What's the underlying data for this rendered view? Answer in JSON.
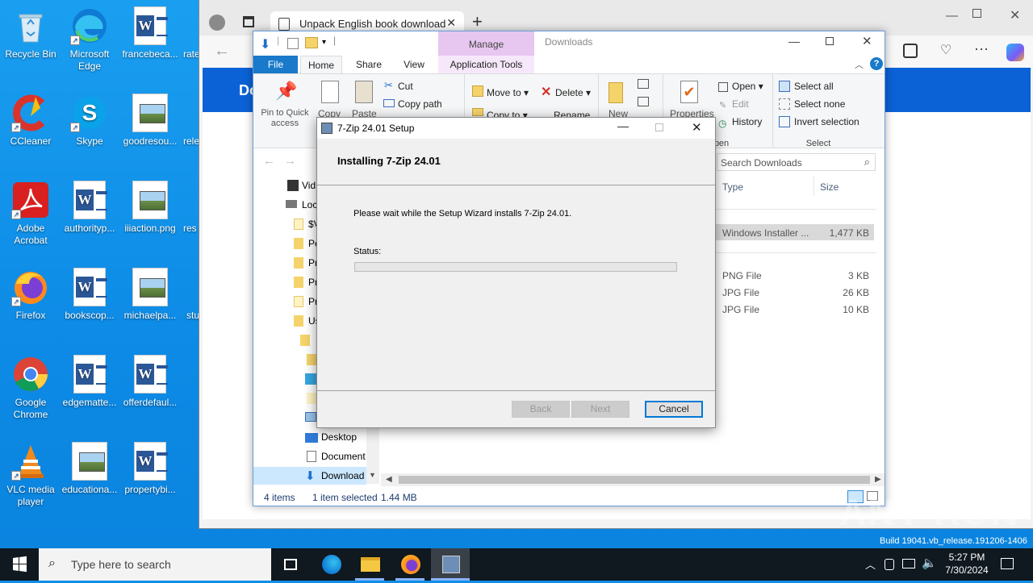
{
  "desktop": {
    "icons": [
      {
        "label": "Recycle Bin",
        "type": "recycle"
      },
      {
        "label": "Microsoft Edge",
        "type": "edge"
      },
      {
        "label": "francebeca...",
        "type": "word"
      },
      {
        "label": "rate",
        "type": "partial"
      },
      {
        "label": "CCleaner",
        "type": "ccleaner"
      },
      {
        "label": "Skype",
        "type": "skype"
      },
      {
        "label": "goodresou...",
        "type": "image"
      },
      {
        "label": "rele",
        "type": "partial"
      },
      {
        "label": "Adobe Acrobat",
        "type": "acrobat"
      },
      {
        "label": "authorityp...",
        "type": "word"
      },
      {
        "label": "iiiaction.png",
        "type": "image"
      },
      {
        "label": "res",
        "type": "partial"
      },
      {
        "label": "Firefox",
        "type": "firefox"
      },
      {
        "label": "bookscop...",
        "type": "word"
      },
      {
        "label": "michaelpa...",
        "type": "image"
      },
      {
        "label": "stu",
        "type": "partial"
      },
      {
        "label": "Google Chrome",
        "type": "chrome"
      },
      {
        "label": "edgematte...",
        "type": "word"
      },
      {
        "label": "offerdefaul...",
        "type": "word"
      },
      {
        "label": "VLC media player",
        "type": "vlc"
      },
      {
        "label": "educationa...",
        "type": "image"
      },
      {
        "label": "propertybi...",
        "type": "word"
      }
    ],
    "watermark": "ANY RUN",
    "build_text": "Build 19041.vb_release.191206-1406"
  },
  "browser": {
    "tab_title": "Unpack English book download",
    "banner_text": "Do"
  },
  "explorer": {
    "title": "Downloads",
    "manage_label": "Manage",
    "tabs": [
      "File",
      "Home",
      "Share",
      "View",
      "Application Tools"
    ],
    "ribbon": {
      "pin_label": "Pin to Quick access",
      "copy_label": "Copy",
      "paste_label": "Paste",
      "cut_label": "Cut",
      "copy_path_label": "Copy path",
      "move_to_label": "Move to",
      "copy_to_label": "Copy to",
      "delete_label": "Delete",
      "rename_label": "Rename",
      "new_label": "New",
      "properties_label": "Properties",
      "open_label": "Open",
      "edit_label": "Edit",
      "history_label": "History",
      "open_group": "pen",
      "select_all_label": "Select all",
      "select_none_label": "Select none",
      "invert_label": "Invert selection",
      "select_group": "Select"
    },
    "search_placeholder": "Search Downloads",
    "columns": {
      "type": "Type",
      "size": "Size"
    },
    "files": [
      {
        "type": "Windows Installer ...",
        "size": "1,477 KB",
        "selected": true
      },
      {
        "type": "PNG File",
        "size": "3 KB",
        "selected": false
      },
      {
        "type": "JPG File",
        "size": "26 KB",
        "selected": false
      },
      {
        "type": "JPG File",
        "size": "10 KB",
        "selected": false
      }
    ],
    "nav": [
      {
        "label": "Vid"
      },
      {
        "label": "Loc"
      },
      {
        "label": "$V"
      },
      {
        "label": "Pe"
      },
      {
        "label": "Pr"
      },
      {
        "label": "Pr"
      },
      {
        "label": "Pr"
      },
      {
        "label": "Us"
      },
      {
        "label": "Desktop"
      },
      {
        "label": "Document"
      },
      {
        "label": "Download"
      }
    ],
    "status": {
      "items": "4 items",
      "selected": "1 item selected",
      "size": "1.44 MB"
    }
  },
  "setup": {
    "title": "7-Zip 24.01 Setup",
    "heading": "Installing 7-Zip 24.01",
    "message": "Please wait while the Setup Wizard installs 7-Zip 24.01.",
    "status_label": "Status:",
    "progress": 0,
    "back": "Back",
    "next": "Next",
    "cancel": "Cancel"
  },
  "taskbar": {
    "search_placeholder": "Type here to search",
    "time": "5:27 PM",
    "date": "7/30/2024"
  }
}
